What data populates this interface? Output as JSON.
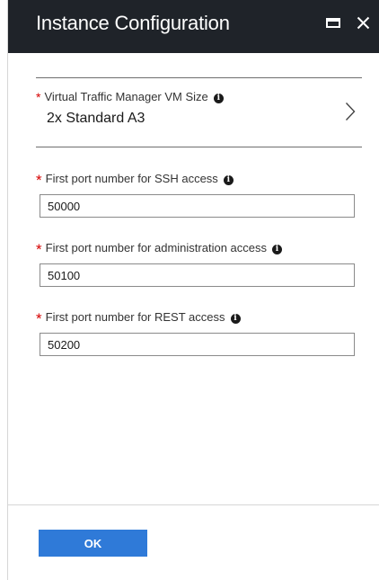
{
  "header": {
    "title": "Instance Configuration",
    "maximize_icon": "maximize-icon",
    "close_icon": "close-icon",
    "background": "#1f2329"
  },
  "vm_size": {
    "required_mark": "*",
    "label": "Virtual Traffic Manager VM Size",
    "value": "2x Standard A3",
    "info_icon": "info-icon",
    "chevron_icon": "chevron-right-icon"
  },
  "fields": [
    {
      "required_mark": "*",
      "label": "First port number for SSH access",
      "value": "50000",
      "info_icon": "info-icon"
    },
    {
      "required_mark": "*",
      "label": "First port number for administration access",
      "value": "50100",
      "info_icon": "info-icon"
    },
    {
      "required_mark": "*",
      "label": "First port number for REST access",
      "value": "50200",
      "info_icon": "info-icon"
    }
  ],
  "footer": {
    "ok_label": "OK"
  },
  "colors": {
    "accent": "#2f7ad8",
    "required": "#d60000"
  }
}
